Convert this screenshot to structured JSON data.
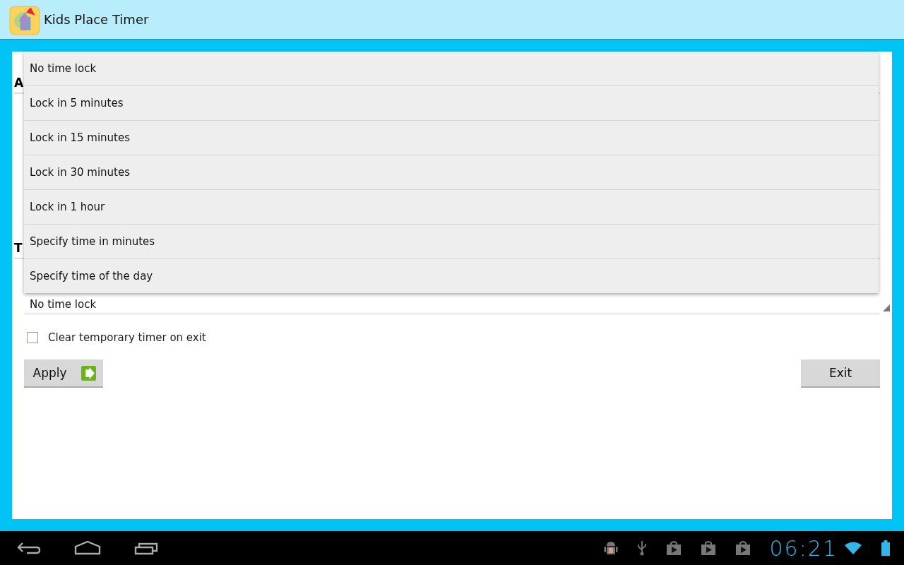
{
  "action_bar": {
    "title": "Kids Place Timer"
  },
  "sections": [
    {
      "heading": "A"
    },
    {
      "heading": "T"
    }
  ],
  "dropdown_menu": {
    "options": [
      {
        "label": "No time lock"
      },
      {
        "label": "Lock in 5 minutes"
      },
      {
        "label": "Lock in 15 minutes"
      },
      {
        "label": "Lock in 30 minutes"
      },
      {
        "label": "Lock in 1 hour"
      },
      {
        "label": "Specify time in minutes"
      },
      {
        "label": "Specify time of the day"
      }
    ]
  },
  "spinner": {
    "value": "No time lock"
  },
  "clear_timer_checkbox": {
    "label": "Clear temporary timer on exit",
    "checked": false
  },
  "buttons": [
    {
      "kind": "apply",
      "label": "Apply"
    },
    {
      "kind": "exit",
      "label": "Exit"
    }
  ],
  "system_bar": {
    "notifications": [
      {
        "kind": "debug"
      },
      {
        "kind": "usb"
      },
      {
        "kind": "store"
      },
      {
        "kind": "store"
      },
      {
        "kind": "store"
      }
    ],
    "time": "06:21"
  }
}
